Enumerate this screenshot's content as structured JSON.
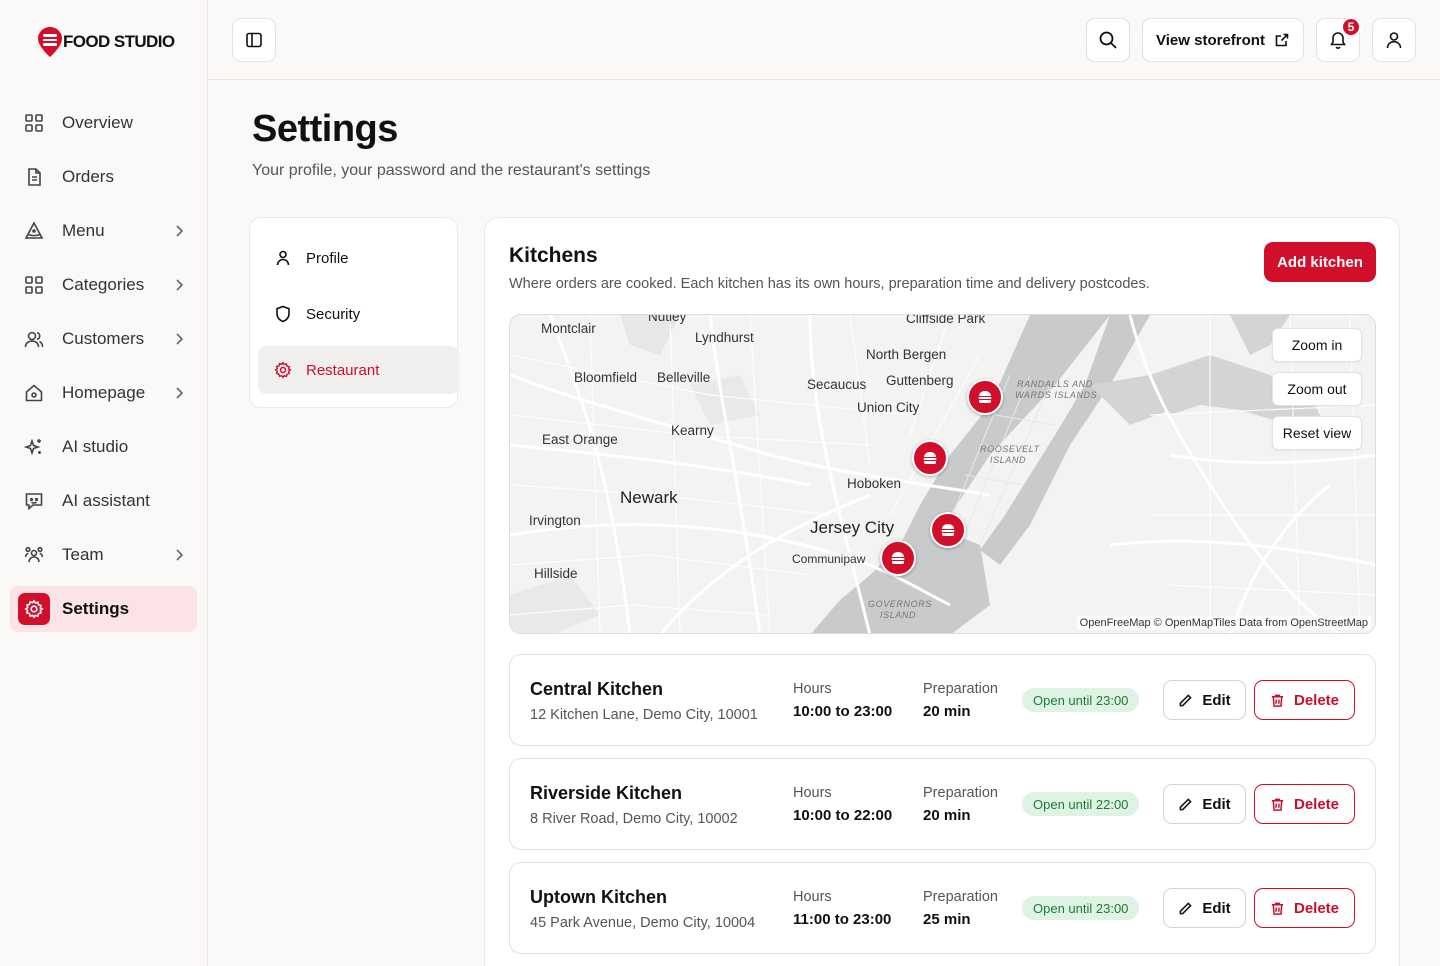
{
  "brand": {
    "name": "FOOD STUDIO",
    "accent": "#d20f2a"
  },
  "sidebar": {
    "items": [
      {
        "label": "Overview",
        "icon": "grid-icon",
        "has_chevron": false
      },
      {
        "label": "Orders",
        "icon": "document-icon",
        "has_chevron": false
      },
      {
        "label": "Menu",
        "icon": "pizza-slice-icon",
        "has_chevron": true
      },
      {
        "label": "Categories",
        "icon": "grid-icon",
        "has_chevron": true
      },
      {
        "label": "Customers",
        "icon": "users-icon",
        "has_chevron": true
      },
      {
        "label": "Homepage",
        "icon": "home-icon",
        "has_chevron": true
      },
      {
        "label": "AI studio",
        "icon": "sparkles-icon",
        "has_chevron": false
      },
      {
        "label": "AI assistant",
        "icon": "chat-bot-icon",
        "has_chevron": false
      },
      {
        "label": "Team",
        "icon": "team-icon",
        "has_chevron": true
      },
      {
        "label": "Settings",
        "icon": "gear-icon",
        "has_chevron": false,
        "active": true
      }
    ]
  },
  "header": {
    "storefront_label": "View storefront",
    "notification_count": "5"
  },
  "page": {
    "title": "Settings",
    "subtitle": "Your profile, your password and the restaurant's settings"
  },
  "subnav": {
    "items": [
      {
        "label": "Profile",
        "icon": "user-icon"
      },
      {
        "label": "Security",
        "icon": "shield-icon"
      },
      {
        "label": "Restaurant",
        "icon": "gear-icon",
        "active": true
      }
    ]
  },
  "kitchens": {
    "title": "Kitchens",
    "subtitle": "Where orders are cooked. Each kitchen has its own hours, preparation time and delivery postcodes.",
    "add_label": "Add kitchen",
    "map": {
      "zoom_in": "Zoom in",
      "zoom_out": "Zoom out",
      "reset": "Reset view",
      "attribution": "OpenFreeMap © OpenMapTiles Data from OpenStreetMap",
      "places": [
        "Nutley",
        "Cliffside Park",
        "Montclair",
        "Lyndhurst",
        "North Bergen",
        "Bloomfield",
        "Belleville",
        "Secaucus",
        "Guttenberg",
        "Union City",
        "East Orange",
        "Kearny",
        "Hoboken",
        "Newark",
        "Irvington",
        "Jersey City",
        "Communipaw",
        "Hillside",
        "RANDALLS AND",
        "WARDS ISLANDS",
        "ROOSEVELT",
        "ISLAND",
        "GOVERNORS",
        "ISLAND"
      ]
    },
    "labels": {
      "hours": "Hours",
      "preparation": "Preparation",
      "edit": "Edit",
      "delete": "Delete"
    },
    "list": [
      {
        "name": "Central Kitchen",
        "address": "12 Kitchen Lane, Demo City, 10001",
        "hours": "10:00 to 23:00",
        "prep": "20 min",
        "status": "Open until 23:00"
      },
      {
        "name": "Riverside Kitchen",
        "address": "8 River Road, Demo City, 10002",
        "hours": "10:00 to 22:00",
        "prep": "20 min",
        "status": "Open until 22:00"
      },
      {
        "name": "Uptown Kitchen",
        "address": "45 Park Avenue, Demo City, 10004",
        "hours": "11:00 to 23:00",
        "prep": "25 min",
        "status": "Open until 23:00"
      }
    ]
  }
}
